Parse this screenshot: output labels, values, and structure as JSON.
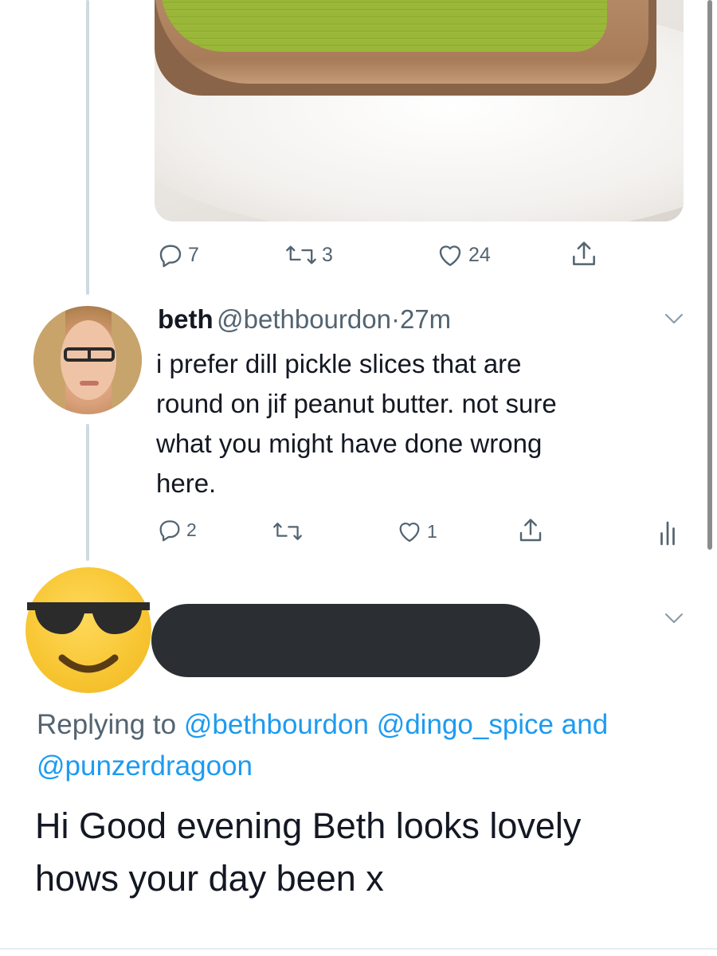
{
  "colors": {
    "accent": "#1d9bf0",
    "secondary_text": "#536471",
    "primary_text": "#141823",
    "thread_line": "#cfd9de"
  },
  "tweet1": {
    "media": "peanut-butter-pickle-toast-photo",
    "actions": {
      "reply_count": "7",
      "retweet_count": "3",
      "like_count": "24"
    }
  },
  "tweet2": {
    "author_name": "beth",
    "author_handle": "@bethbourdon",
    "time": "27m",
    "separator": "·",
    "text_lines": [
      "i prefer dill pickle slices that are",
      "round on jif peanut butter. not sure",
      "what you might have done wrong",
      "here."
    ],
    "actions": {
      "reply_count": "2",
      "retweet_count": "",
      "like_count": "1"
    }
  },
  "tweet3": {
    "avatar": "sunglasses-emoji",
    "author_redacted": true,
    "replying_prefix": "Replying to",
    "replying_handles": [
      "@bethbourdon",
      "@dingo_spice"
    ],
    "replying_and": "and",
    "replying_last": "@punzerdragoon",
    "text_lines": [
      "Hi Good evening Beth looks lovely",
      "hows your day been x"
    ]
  }
}
